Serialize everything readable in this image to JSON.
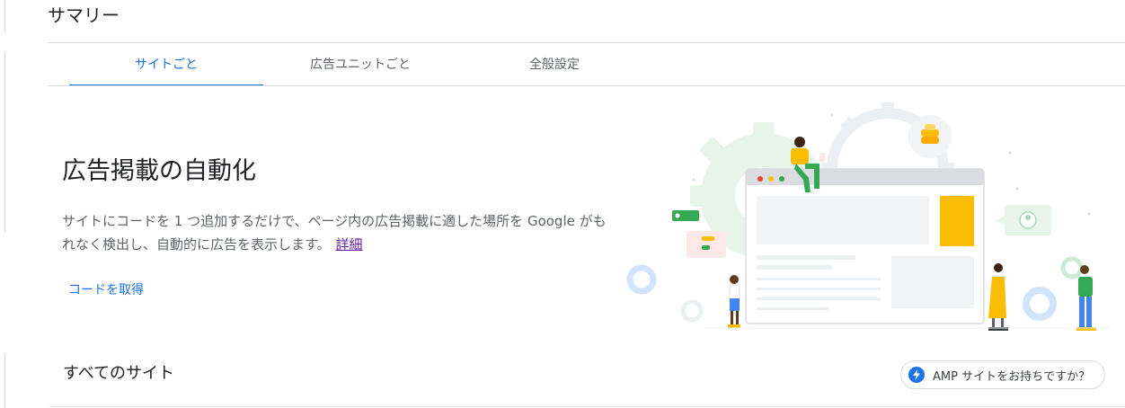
{
  "header": {
    "title": "サマリー"
  },
  "tabs": [
    {
      "label": "サイトごと",
      "active": true
    },
    {
      "label": "広告ユニットごと",
      "active": false
    },
    {
      "label": "全般設定",
      "active": false
    }
  ],
  "hero": {
    "title": "広告掲載の自動化",
    "description": "サイトにコードを 1 つ追加するだけで、ページ内の広告掲載に適した場所を Google がもれなく検出し、自動的に広告を表示します。",
    "learn_more": "詳細",
    "get_code": "コードを取得"
  },
  "sites": {
    "title": "すべてのサイト",
    "amp_chip": "AMP サイトをお持ちですか？",
    "amp_icon": "lightning-bolt-icon"
  },
  "colors": {
    "accent": "#1a73e8",
    "link_visited": "#681da8",
    "gear_green": "#e6f4ea",
    "gear_grey": "#f1f3f4",
    "yellow": "#fbbc04"
  }
}
